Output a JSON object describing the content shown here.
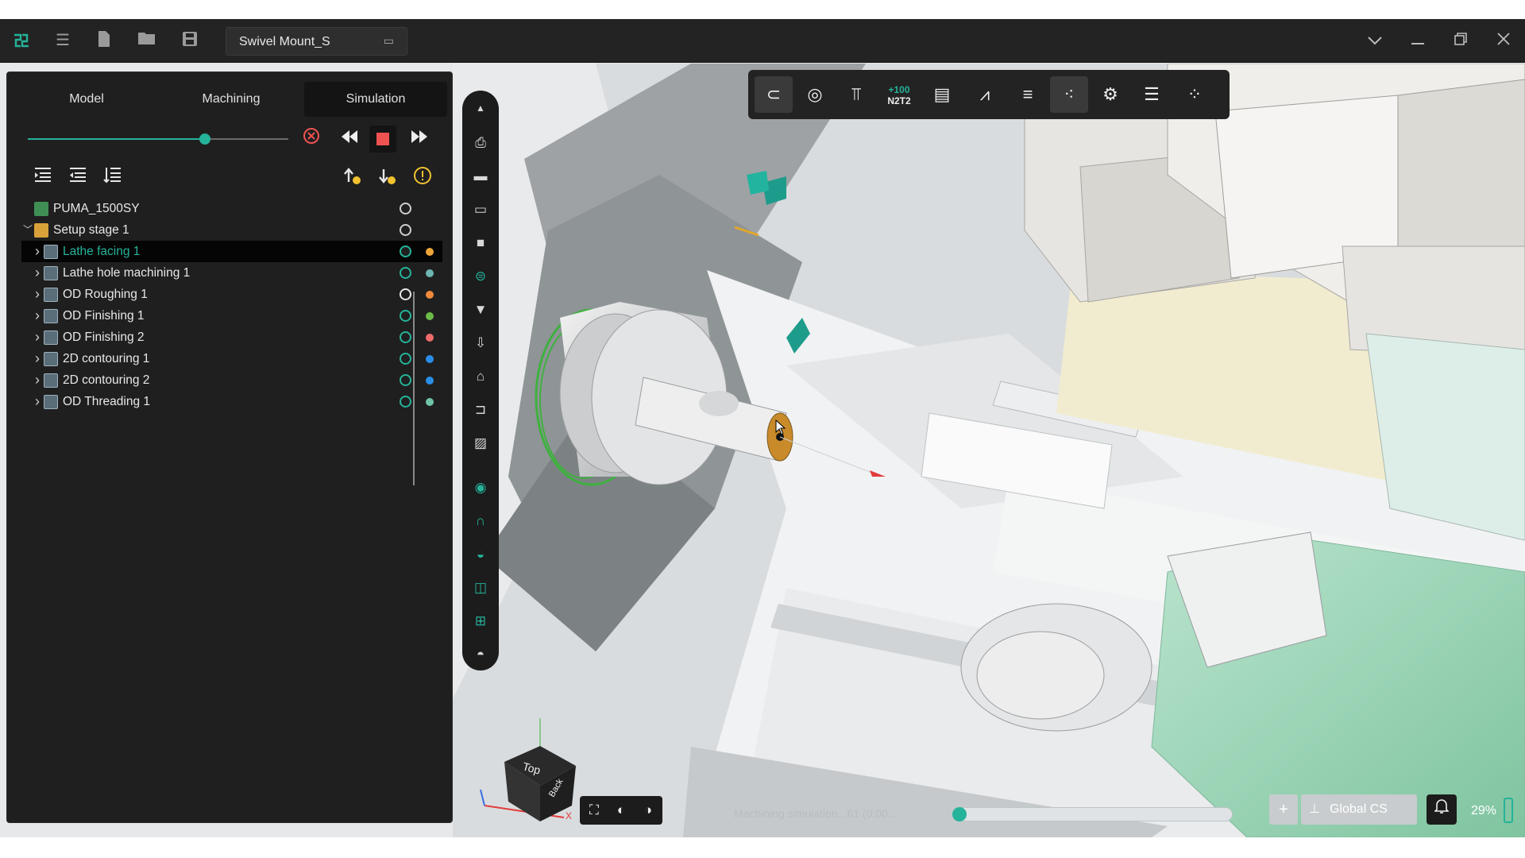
{
  "window": {
    "title": "Swivel Mount_S"
  },
  "titlebar": {
    "icons": [
      "app-logo-icon",
      "menu-icon",
      "new-file-icon",
      "open-folder-icon",
      "save-icon"
    ],
    "title_sub_icon": "▭",
    "window_controls": [
      "chevron-down-icon",
      "minimize-icon",
      "maximize-icon",
      "close-icon"
    ]
  },
  "tabs": [
    {
      "label": "Model",
      "active": false
    },
    {
      "label": "Machining",
      "active": false
    },
    {
      "label": "Simulation",
      "active": true
    }
  ],
  "simulation": {
    "progress": 0.68,
    "accent": "#25b39a",
    "stop_color": "#f05252"
  },
  "tree": {
    "machine": "PUMA_1500SY",
    "setup": "Setup stage 1",
    "operations": [
      {
        "label": "Lathe facing 1",
        "color": "#f0a53a",
        "selected": true
      },
      {
        "label": "Lathe hole machining 1",
        "color": "#6fb6b0",
        "selected": false
      },
      {
        "label": "OD Roughing 1",
        "color": "#f08a3a",
        "selected": false
      },
      {
        "label": "OD Finishing 1",
        "color": "#6dbb4a",
        "selected": false
      },
      {
        "label": "OD Finishing 2",
        "color": "#ef6a6a",
        "selected": false
      },
      {
        "label": "2D contouring 1",
        "color": "#2a8ee8",
        "selected": false
      },
      {
        "label": "2D contouring 2",
        "color": "#2a8ee8",
        "selected": false
      },
      {
        "label": "OD Threading 1",
        "color": "#6fc5a8",
        "selected": false
      }
    ]
  },
  "toolbar": {
    "n2t2_top": "+100",
    "n2t2_bottom": "N2T2"
  },
  "viewport": {
    "cube_top": "Top",
    "cube_back": "Back",
    "axis_x": "X"
  },
  "status": {
    "text": "Machining simulation...61 (0.00...",
    "progress": 0.0
  },
  "coord_system": {
    "label": "Global CS"
  },
  "zoom": {
    "label": "29%"
  }
}
